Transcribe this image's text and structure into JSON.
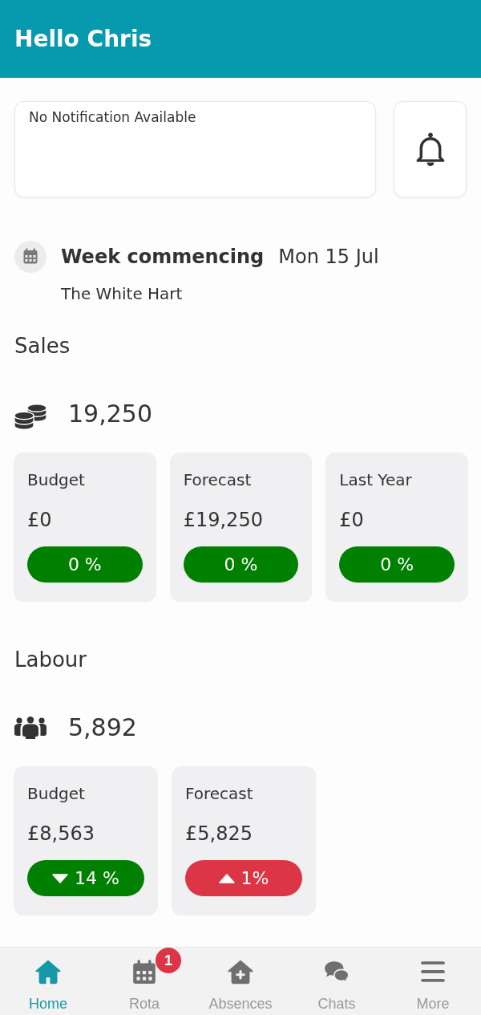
{
  "header": {
    "title": "Hello Chris"
  },
  "notifications": {
    "message": "No Notification Available"
  },
  "week": {
    "label": "Week commencing",
    "date": "Mon 15 Jul",
    "site": "The White Hart"
  },
  "sections": [
    {
      "title": "Sales",
      "total": "19,250",
      "cards": [
        {
          "kind": "flat",
          "label": "Budget",
          "value": "£0",
          "change": "0 %",
          "color": "#008000"
        },
        {
          "kind": "flat",
          "label": "Forecast",
          "value": "£19,250",
          "change": "0 %",
          "color": "#008000"
        },
        {
          "kind": "flat",
          "label": "Last Year",
          "value": "£0",
          "change": "0 %",
          "color": "#008000"
        }
      ]
    },
    {
      "title": "Labour",
      "total": "5,892",
      "cards": [
        {
          "kind": "down",
          "label": "Budget",
          "value": "£8,563",
          "change": "14 %",
          "color": "#008000"
        },
        {
          "kind": "up",
          "label": "Forecast",
          "value": "£5,825",
          "change": "1%",
          "color": "#dc3545"
        }
      ]
    }
  ],
  "nav": {
    "items": [
      {
        "label": "Home",
        "selected": true
      },
      {
        "label": "Rota",
        "selected": false,
        "badge": "1"
      },
      {
        "label": "Absences",
        "selected": false
      },
      {
        "label": "Chats",
        "selected": false
      },
      {
        "label": "More",
        "selected": false
      }
    ]
  }
}
